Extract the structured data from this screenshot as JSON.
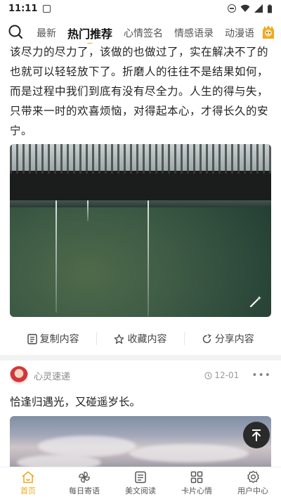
{
  "status": {
    "time": "11:11"
  },
  "tabs": [
    {
      "label": "最新"
    },
    {
      "label": "热门推荐"
    },
    {
      "label": "心情签名"
    },
    {
      "label": "情感语录"
    },
    {
      "label": "动漫语"
    }
  ],
  "article": {
    "text": "该尽力的尽力了，该做的也做过了，实在解决不了的也就可以轻轻放下了。折磨人的往往不是结果如何，而是过程中我们到底有没有尽全力。人生的得与失，只带来一时的欢喜烦恼，对得起本心，才得长久的安宁。"
  },
  "actions": {
    "copy": "复制内容",
    "collect": "收藏内容",
    "share": "分享内容"
  },
  "card": {
    "username": "心灵速递",
    "date": "12-01",
    "more": "•••",
    "quote": "恰逢归遇光，又碰遥岁长。"
  },
  "bottom_nav": [
    {
      "label": "首页",
      "icon": "home-icon"
    },
    {
      "label": "每日寄语",
      "icon": "pinwheel-icon"
    },
    {
      "label": "美文阅读",
      "icon": "document-icon"
    },
    {
      "label": "卡片心情",
      "icon": "grid-icon"
    },
    {
      "label": "用户中心",
      "icon": "gear-icon"
    }
  ],
  "colors": {
    "accent": "#f0a81e",
    "text": "#222222",
    "muted": "#888888"
  }
}
